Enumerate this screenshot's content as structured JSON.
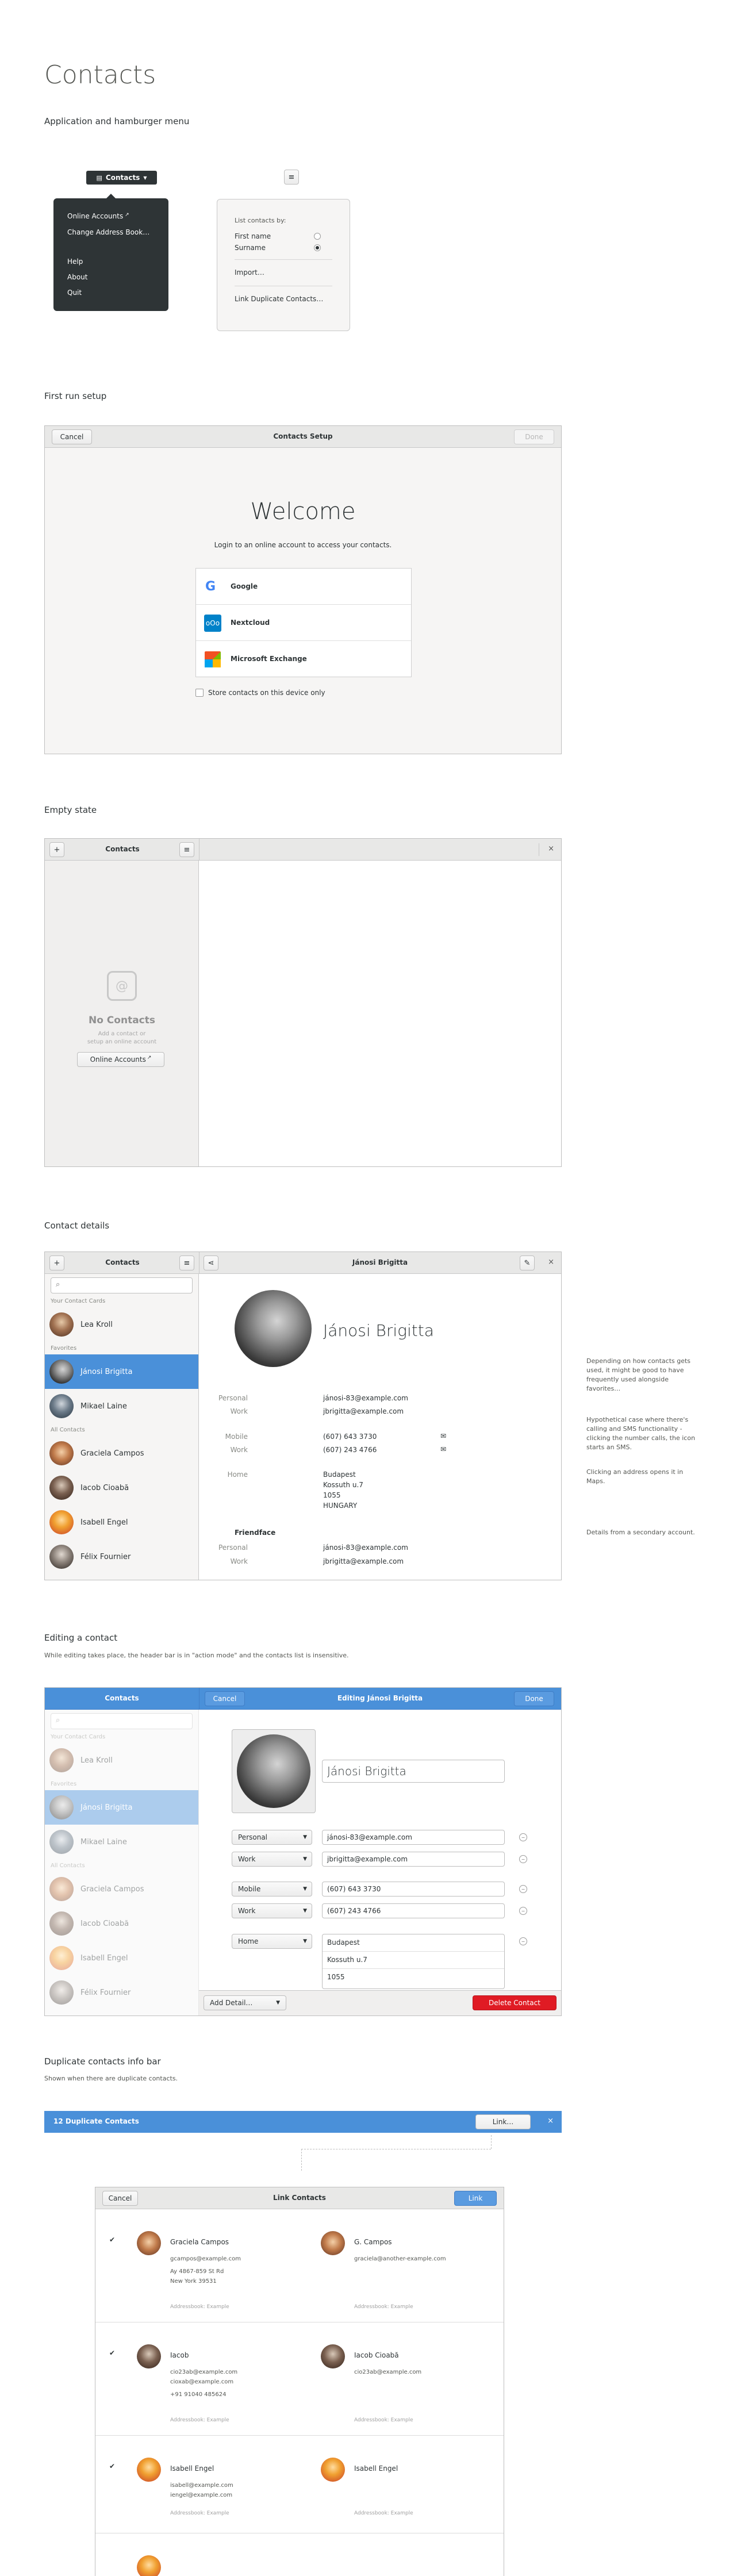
{
  "page": {
    "title": "Contacts"
  },
  "sections": {
    "menu": "Application and hamburger menu",
    "first_run": "First run setup",
    "empty": "Empty state",
    "details": "Contact details",
    "editing": "Editing a contact",
    "editing_sub": "While editing takes place, the header bar is in \"action mode\" and the contacts list is insensitive.",
    "duplicates": "Duplicate contacts info bar",
    "duplicates_sub": "Shown when there are duplicate contacts."
  },
  "app_menu": {
    "button": "Contacts",
    "items": [
      "Online Accounts",
      "Change Address Book…",
      "Help",
      "About",
      "Quit"
    ]
  },
  "hamburger": {
    "heading": "List contacts by:",
    "options": [
      {
        "label": "First name",
        "selected": false
      },
      {
        "label": "Surname",
        "selected": true
      }
    ],
    "import": "Import…",
    "link_dup": "Link Duplicate Contacts…"
  },
  "setup": {
    "cancel": "Cancel",
    "title": "Contacts Setup",
    "done": "Done",
    "welcome": "Welcome",
    "prompt": "Login to an online account to access your contacts.",
    "providers": [
      {
        "name": "Google",
        "icon": "google-icon"
      },
      {
        "name": "Nextcloud",
        "icon": "nextcloud-icon"
      },
      {
        "name": "Microsoft Exchange",
        "icon": "exchange-icon"
      }
    ],
    "local_only": "Store contacts on this device only"
  },
  "empty": {
    "title": "Contacts",
    "heading": "No Contacts",
    "hint_line1": "Add a contact or",
    "hint_line2": "setup an online account",
    "button": "Online Accounts"
  },
  "details": {
    "list_title": "Contacts",
    "contact_title": "Jánosi Brigitta",
    "groups": {
      "frequent": "Your Contact Cards",
      "favorites": "Favorites",
      "all": "All Contacts"
    },
    "contacts": [
      {
        "name": "Lea Kroll"
      },
      {
        "name": "Jánosi Brigitta"
      },
      {
        "name": "Mikael Laine"
      },
      {
        "name": "Graciela Campos"
      },
      {
        "name": "Iacob Cioabă"
      },
      {
        "name": "Isabell Engel"
      },
      {
        "name": "Félix Fournier"
      }
    ],
    "name": "Jánosi Brigitta",
    "fields": [
      {
        "label": "Personal",
        "value": "jánosi-83@example.com"
      },
      {
        "label": "Work",
        "value": "jbrigitta@example.com"
      },
      {
        "label": "Mobile",
        "value": "(607) 643 3730"
      },
      {
        "label": "Work",
        "value": "(607) 243 4766"
      },
      {
        "label": "Home",
        "value": "Budapest"
      }
    ],
    "address": [
      "Kossuth u.7",
      "1055",
      "HUNGARY"
    ],
    "secondary_title": "Friendface",
    "secondary_fields": [
      {
        "label": "Personal",
        "value": "jánosi-83@example.com"
      },
      {
        "label": "Work",
        "value": "jbrigitta@example.com"
      }
    ],
    "notes": [
      "Depending on how contacts gets used, it might be good to have frequently used alongside favorites…",
      "Hypothetical case where there's calling and SMS functionality - clicking the number calls, the icon starts an SMS.",
      "Clicking an address opens it in Maps.",
      "Details from a secondary account."
    ]
  },
  "editing": {
    "list_title": "Contacts",
    "cancel": "Cancel",
    "title": "Editing Jánosi Brigitta",
    "done": "Done",
    "name": "Jánosi Brigitta",
    "rows": [
      {
        "type": "Personal",
        "value": "jánosi-83@example.com"
      },
      {
        "type": "Work",
        "value": "jbrigitta@example.com"
      },
      {
        "type": "Mobile",
        "value": "(607) 643 3730"
      },
      {
        "type": "Work",
        "value": "(607) 243 4766"
      },
      {
        "type": "Home",
        "value": "Budapest"
      }
    ],
    "address": [
      "Kossuth u.7",
      "1055"
    ],
    "add_detail": "Add Detail…",
    "delete": "Delete Contact"
  },
  "duplicates": {
    "bar_text": "12 Duplicate Contacts",
    "link": "Link…",
    "dialog": {
      "cancel": "Cancel",
      "title": "Link Contacts",
      "link": "Link"
    },
    "pairs": [
      {
        "left": {
          "name": "Graciela Campos",
          "details": [
            "gcampos@example.com",
            "Ay 4867-859 St Rd",
            "New York 39531"
          ],
          "source": "Addressbook: Example"
        },
        "right": {
          "name": "G. Campos",
          "details": [
            "graciela@another-example.com"
          ],
          "source": "Addressbook: Example"
        }
      },
      {
        "left": {
          "name": "Iacob",
          "details": [
            "cio23ab@example.com",
            "cioxab@example.com",
            "+91 91040 485624"
          ],
          "source": "Addressbook: Example"
        },
        "right": {
          "name": "Iacob Cioabă",
          "details": [
            "cio23ab@example.com"
          ],
          "source": "Addressbook: Example"
        }
      },
      {
        "left": {
          "name": "Isabell Engel",
          "details": [
            "isabell@example.com",
            "iengel@example.com"
          ],
          "source": "Addressbook: Example"
        },
        "right": {
          "name": "Isabell Engel",
          "details": [],
          "source": "Addressbook: Example"
        }
      }
    ]
  }
}
